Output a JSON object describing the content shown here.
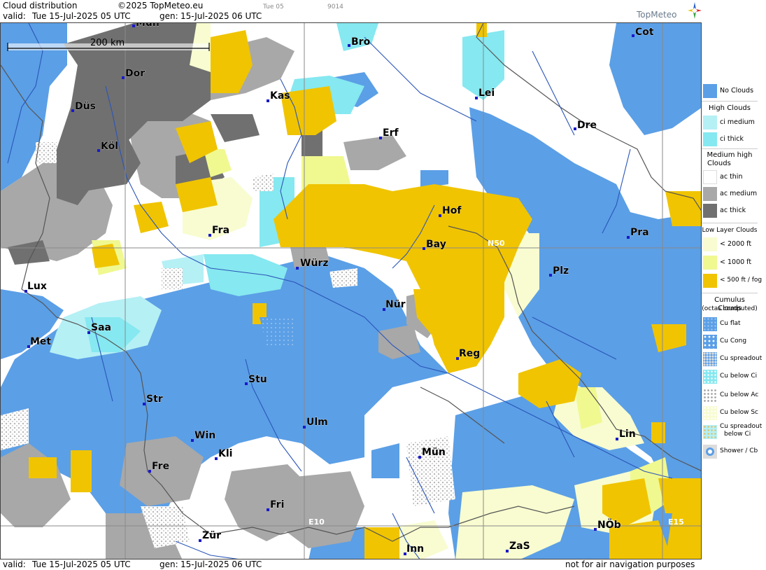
{
  "header": {
    "product": "Cloud distribution",
    "copyright": "©2025 TopMeteo.eu",
    "valid_label": "valid:",
    "valid_value": "Tue  15-Jul-2025  05 UTC",
    "gen_label": "gen:",
    "gen_value": "15-Jul-2025 06 UTC",
    "tab_small": "Tue 05",
    "code_small": "9014",
    "brand": "TopMeteo"
  },
  "scale": {
    "label": "200 km"
  },
  "grid_labels": {
    "n50": "N50",
    "e10": "E10",
    "e15": "E15"
  },
  "cities": [
    {
      "name": "Mün",
      "id": "muenster"
    },
    {
      "name": "Bro",
      "id": "brocken"
    },
    {
      "name": "Cot",
      "id": "cottbus"
    },
    {
      "name": "Dor",
      "id": "dortmund"
    },
    {
      "name": "Kas",
      "id": "kassel"
    },
    {
      "name": "Lei",
      "id": "leipzig"
    },
    {
      "name": "Düs",
      "id": "duesseldorf"
    },
    {
      "name": "Dre",
      "id": "dresden"
    },
    {
      "name": "Erf",
      "id": "erfurt"
    },
    {
      "name": "Köl",
      "id": "koeln"
    },
    {
      "name": "Hof",
      "id": "hof"
    },
    {
      "name": "Pra",
      "id": "praha"
    },
    {
      "name": "Fra",
      "id": "frankfurt"
    },
    {
      "name": "Bay",
      "id": "bayreuth"
    },
    {
      "name": "Würz",
      "id": "wuerzburg"
    },
    {
      "name": "Plz",
      "id": "plzen"
    },
    {
      "name": "Lux",
      "id": "luxembourg"
    },
    {
      "name": "Nür",
      "id": "nuernberg"
    },
    {
      "name": "Saa",
      "id": "saarbruecken"
    },
    {
      "name": "Met",
      "id": "metz"
    },
    {
      "name": "Reg",
      "id": "regensburg"
    },
    {
      "name": "Stu",
      "id": "stuttgart"
    },
    {
      "name": "Str",
      "id": "strasbourg"
    },
    {
      "name": "Ulm",
      "id": "ulm"
    },
    {
      "name": "Win",
      "id": "winterbach"
    },
    {
      "name": "Lin",
      "id": "linz"
    },
    {
      "name": "Kli",
      "id": "klippeneck"
    },
    {
      "name": "Mün",
      "id": "muenchen"
    },
    {
      "name": "Fre",
      "id": "freiburg"
    },
    {
      "name": "Fri",
      "id": "friedrichshafen"
    },
    {
      "name": "NÖb",
      "id": "noeb"
    },
    {
      "name": "Zür",
      "id": "zuerich"
    },
    {
      "name": "Inn",
      "id": "innsbruck"
    },
    {
      "name": "ZaS",
      "id": "zellamsee"
    }
  ],
  "legend": {
    "no_clouds": "No Clouds",
    "high_head": "High Clouds",
    "ci_medium": "ci medium",
    "ci_thick": "ci thick",
    "medium_head_1": "Medium high",
    "medium_head_2": "Clouds",
    "ac_thin": "ac thin",
    "ac_medium": "ac medium",
    "ac_thick": "ac thick",
    "low_head": "Low Layer Clouds",
    "low_2000": "< 2000 ft",
    "low_1000": "< 1000 ft",
    "low_500": "< 500 ft / fog",
    "cu_head_1": "Cumulus Clouds",
    "cu_head_2": "(octas computed)",
    "cu_flat": "Cu flat",
    "cu_cong": "Cu Cong",
    "cu_spreadout": "Cu spreadout",
    "cu_below_ci": "Cu below Ci",
    "cu_below_ac": "Cu below Ac",
    "cu_below_sc": "Cu below Sc",
    "cu_spreadout_ci_1": "Cu spreadout",
    "cu_spreadout_ci_2": "below Ci",
    "shower": "Shower / Cb"
  },
  "footer": {
    "valid_label": "valid:",
    "valid_value": "Tue  15-Jul-2025  05 UTC",
    "gen_label": "gen:",
    "gen_value": "15-Jul-2025 06 UTC",
    "disclaimer": "not for air navigation purposes"
  },
  "colors": {
    "no_clouds": "#5b9fe6",
    "ci_medium": "#b5f0f5",
    "ci_thick": "#86e8f0",
    "ac_thin": "#ffffff",
    "ac_medium": "#a8a8a8",
    "ac_thick": "#707070",
    "low_2000": "#f8fcd0",
    "low_1000": "#f0f890",
    "low_500": "#f0c400",
    "river": "#2a55b8",
    "border": "#555555"
  }
}
